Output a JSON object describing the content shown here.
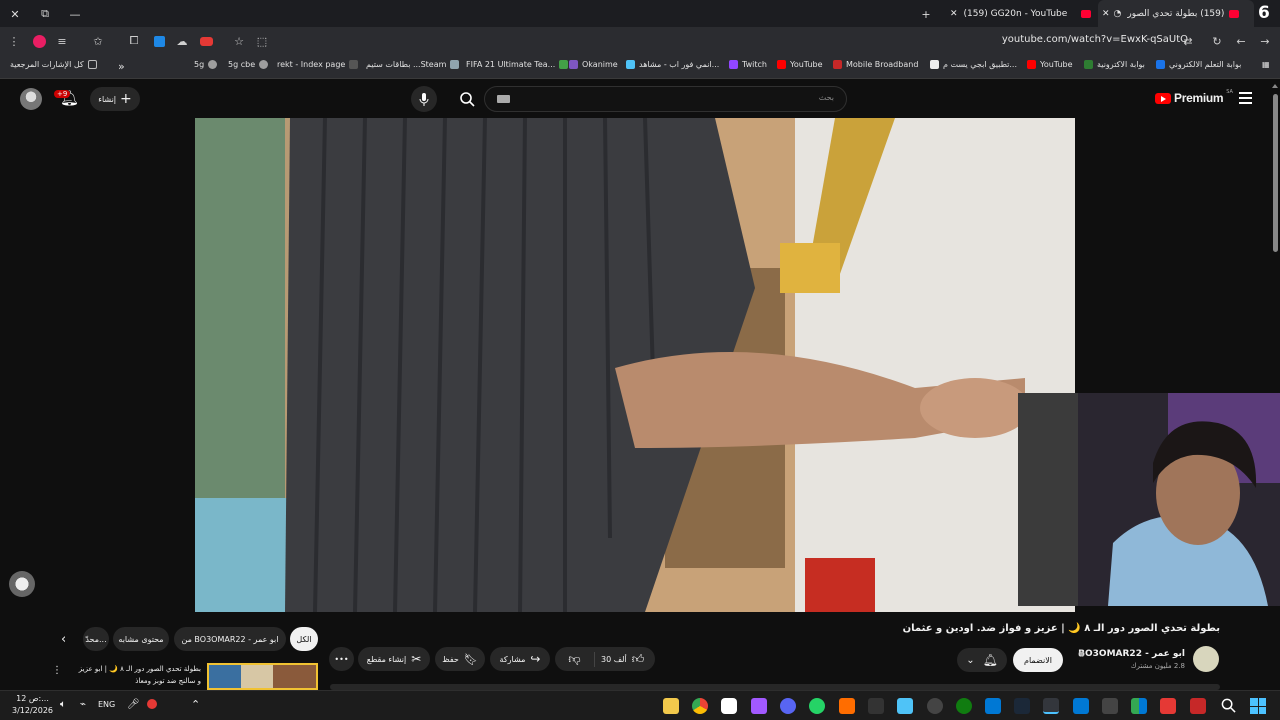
{
  "tabs": {
    "active_title": "(159) بطولة تحدي الصور دور...",
    "inactive_title": "(159) GG20n - YouTube",
    "new_tab": "+",
    "badge": "6"
  },
  "toolbar": {
    "url": "youtube.com/watch?v=EwxK-qSaUtQ"
  },
  "bookmarks": [
    {
      "label": "بوابة التعلم الالكتروني",
      "color": "#1a73e8"
    },
    {
      "label": "بوابة الاكترونية",
      "color": "#2e7d32"
    },
    {
      "label": "YouTube",
      "color": "#ff0000"
    },
    {
      "label": "تطبيق ابجي يست م...",
      "color": "#eeeeee"
    },
    {
      "label": "Mobile Broadband",
      "color": "#c62828"
    },
    {
      "label": "YouTube",
      "color": "#ff0000"
    },
    {
      "label": "Twitch",
      "color": "#9146ff"
    },
    {
      "label": "انمي فور اب - مشاهد...",
      "color": "#4fc3f7"
    },
    {
      "label": "Okanime",
      "color": "#7e57c2"
    },
    {
      "label": "FIFA 21 Ultimate Tea...",
      "color": "#43a047"
    },
    {
      "label": "بطاقات ستيم ...Steam",
      "color": "#90a4ae"
    },
    {
      "label": "rekt - Index page",
      "color": "#555555"
    },
    {
      "label": "5g cbe",
      "color": "#9e9e9e"
    },
    {
      "label": "5g",
      "color": "#9e9e9e"
    }
  ],
  "bookmarks_all": "كل الإشارات المرجعية",
  "bookmarks_overflow": "»",
  "yt": {
    "logo": "Premium",
    "logo_region": "SA",
    "search_placeholder": "بحث",
    "create_label": "إنشاء",
    "notif_count": "+9"
  },
  "video": {
    "title": "بطولة تحدي الصور دور الـ ٨ 🌙 | عزيز و فواز ضد. اودين و عثمان",
    "channel": "ابو عمر - BO3OMAR22",
    "subscribers": "2.8 مليون مشترك",
    "join": "الانضمام",
    "likes": "30 ألف",
    "share": "مشاركة",
    "save": "حفظ",
    "clip": "إنشاء مقطع",
    "more": "•••"
  },
  "chips": {
    "all": "الكل",
    "from_channel": "من BO3OMAR22 - ابو عمر",
    "related": "محتوى مشابه",
    "recent": "محدّ..."
  },
  "next_video": {
    "title_line1": "بطولة تحدي الصور دور الـ ٨ 🌙 | ابو عزيز",
    "title_line2": "و سالنج ضد توبز ومعاذ"
  },
  "taskbar": {
    "time": "ص 12:...",
    "date": "3/12/2026",
    "lang": "ENG"
  }
}
